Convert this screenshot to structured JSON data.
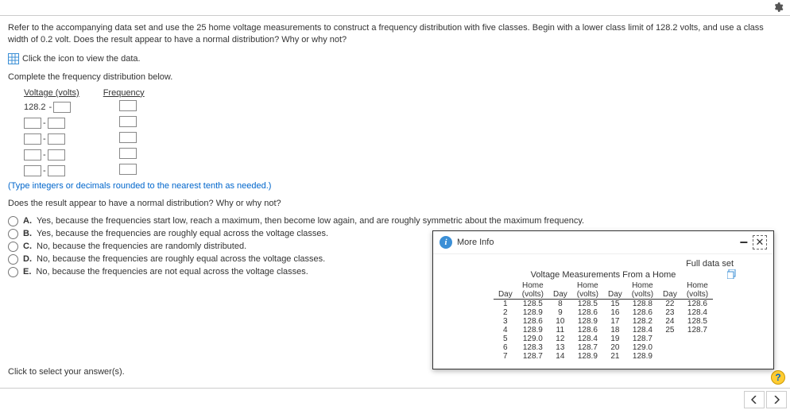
{
  "question": {
    "text": "Refer to the accompanying data set and use the 25 home voltage measurements to construct a frequency distribution with five classes. Begin with a lower class limit of 128.2 volts, and use a class width of 0.2 volt. Does the result appear to have a normal distribution? Why or why not?",
    "icon_hint": "Click the icon to view the data.",
    "complete_hint": "Complete the frequency distribution below.",
    "col1": "Voltage (volts)",
    "col2": "Frequency",
    "fixed_start": "128.2",
    "type_hint": "(Type integers or decimals rounded to the nearest tenth as needed.)",
    "mc_prompt": "Does the result appear to have a normal distribution? Why or why not?",
    "options": [
      {
        "letter": "A.",
        "text": "Yes, because the frequencies start low, reach a maximum, then become low again, and are roughly symmetric about the maximum frequency."
      },
      {
        "letter": "B.",
        "text": "Yes, because the frequencies are roughly equal across the voltage classes."
      },
      {
        "letter": "C.",
        "text": "No, because the frequencies are randomly distributed."
      },
      {
        "letter": "D.",
        "text": "No, because the frequencies are roughly equal across the voltage classes."
      },
      {
        "letter": "E.",
        "text": "No, because the frequencies are not equal across the voltage classes."
      }
    ],
    "select_hint": "Click to select your answer(s)."
  },
  "popup": {
    "title": "More Info",
    "full_link": "Full data set",
    "table_title": "Voltage Measurements From a Home",
    "group_headers": [
      "Home",
      "Home",
      "Home",
      "Home"
    ],
    "col_headers": [
      "Day",
      "(volts)",
      "Day",
      "(volts)",
      "Day",
      "(volts)",
      "Day",
      "(volts)"
    ],
    "rows": [
      [
        "1",
        "128.5",
        "8",
        "128.5",
        "15",
        "128.8",
        "22",
        "128.6"
      ],
      [
        "2",
        "128.9",
        "9",
        "128.6",
        "16",
        "128.6",
        "23",
        "128.4"
      ],
      [
        "3",
        "128.6",
        "10",
        "128.9",
        "17",
        "128.2",
        "24",
        "128.5"
      ],
      [
        "4",
        "128.9",
        "11",
        "128.6",
        "18",
        "128.4",
        "25",
        "128.7"
      ],
      [
        "5",
        "129.0",
        "12",
        "128.4",
        "19",
        "128.7",
        "",
        ""
      ],
      [
        "6",
        "128.3",
        "13",
        "128.7",
        "20",
        "129.0",
        "",
        ""
      ],
      [
        "7",
        "128.7",
        "14",
        "128.9",
        "21",
        "128.9",
        "",
        ""
      ]
    ]
  }
}
